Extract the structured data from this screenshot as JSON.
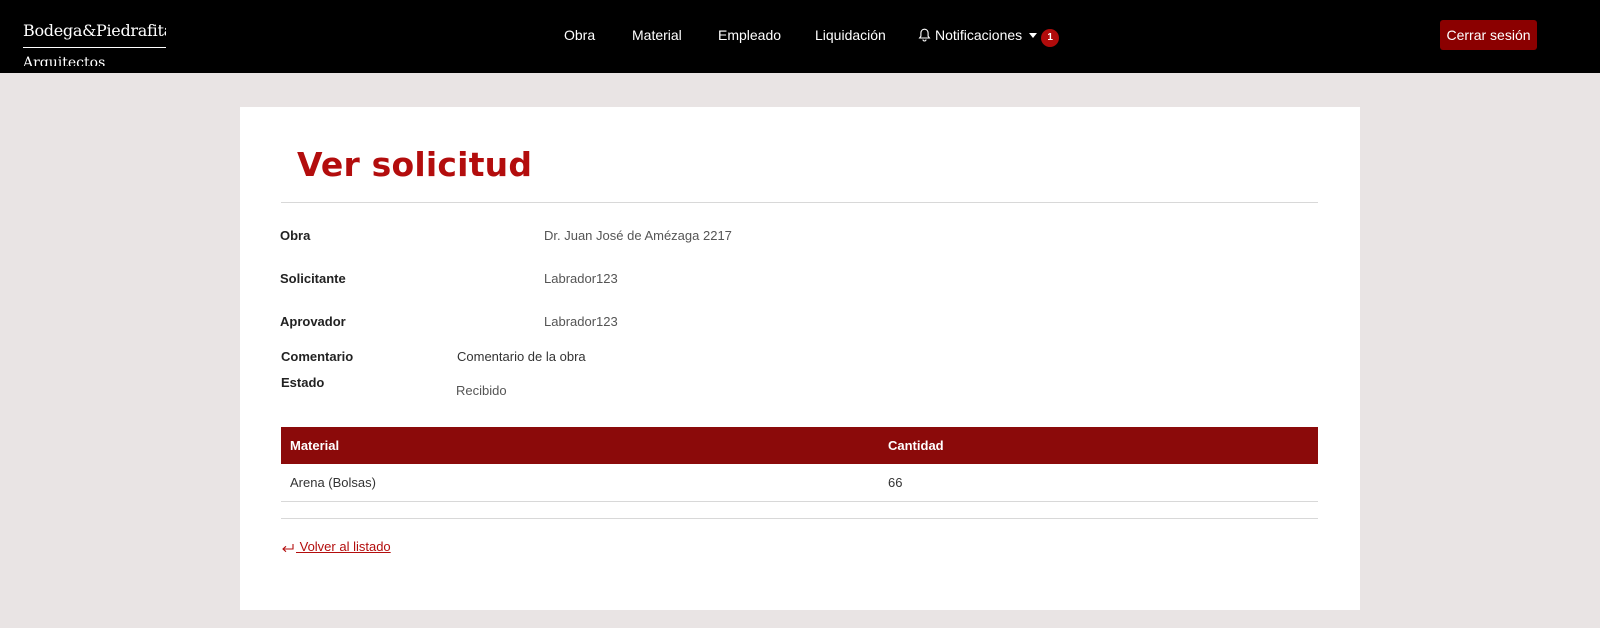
{
  "brand": {
    "name": "Bodega&Piedrafita",
    "sub": "Arquitectos"
  },
  "nav": {
    "items": [
      {
        "label": "Obra"
      },
      {
        "label": "Material"
      },
      {
        "label": "Empleado"
      },
      {
        "label": "Liquidación"
      }
    ],
    "notifications": {
      "label": "Notificaciones",
      "count": "1",
      "icon": "bell-icon"
    },
    "logout_label": "Cerrar sesión"
  },
  "colors": {
    "navbar": "#000000",
    "accent": "#8b0a0a",
    "title": "#b30d0d",
    "background": "#e9e4e4"
  },
  "page": {
    "title": "Ver solicitud"
  },
  "fields": {
    "obra": {
      "label": "Obra",
      "value": "Dr. Juan José de Amézaga 2217"
    },
    "solicitante": {
      "label": "Solicitante",
      "value": "Labrador123"
    },
    "aprovador": {
      "label": "Aprovador",
      "value": "Labrador123"
    },
    "comentario": {
      "label": "Comentario",
      "value": "Comentario de la obra"
    },
    "estado": {
      "label": "Estado",
      "value": "Recibido"
    }
  },
  "table": {
    "headers": [
      "Material",
      "Cantidad"
    ],
    "rows": [
      [
        "Arena (Bolsas)",
        "66"
      ]
    ]
  },
  "back_link": {
    "label": " Volver al listado",
    "icon": "return-arrow-icon"
  }
}
